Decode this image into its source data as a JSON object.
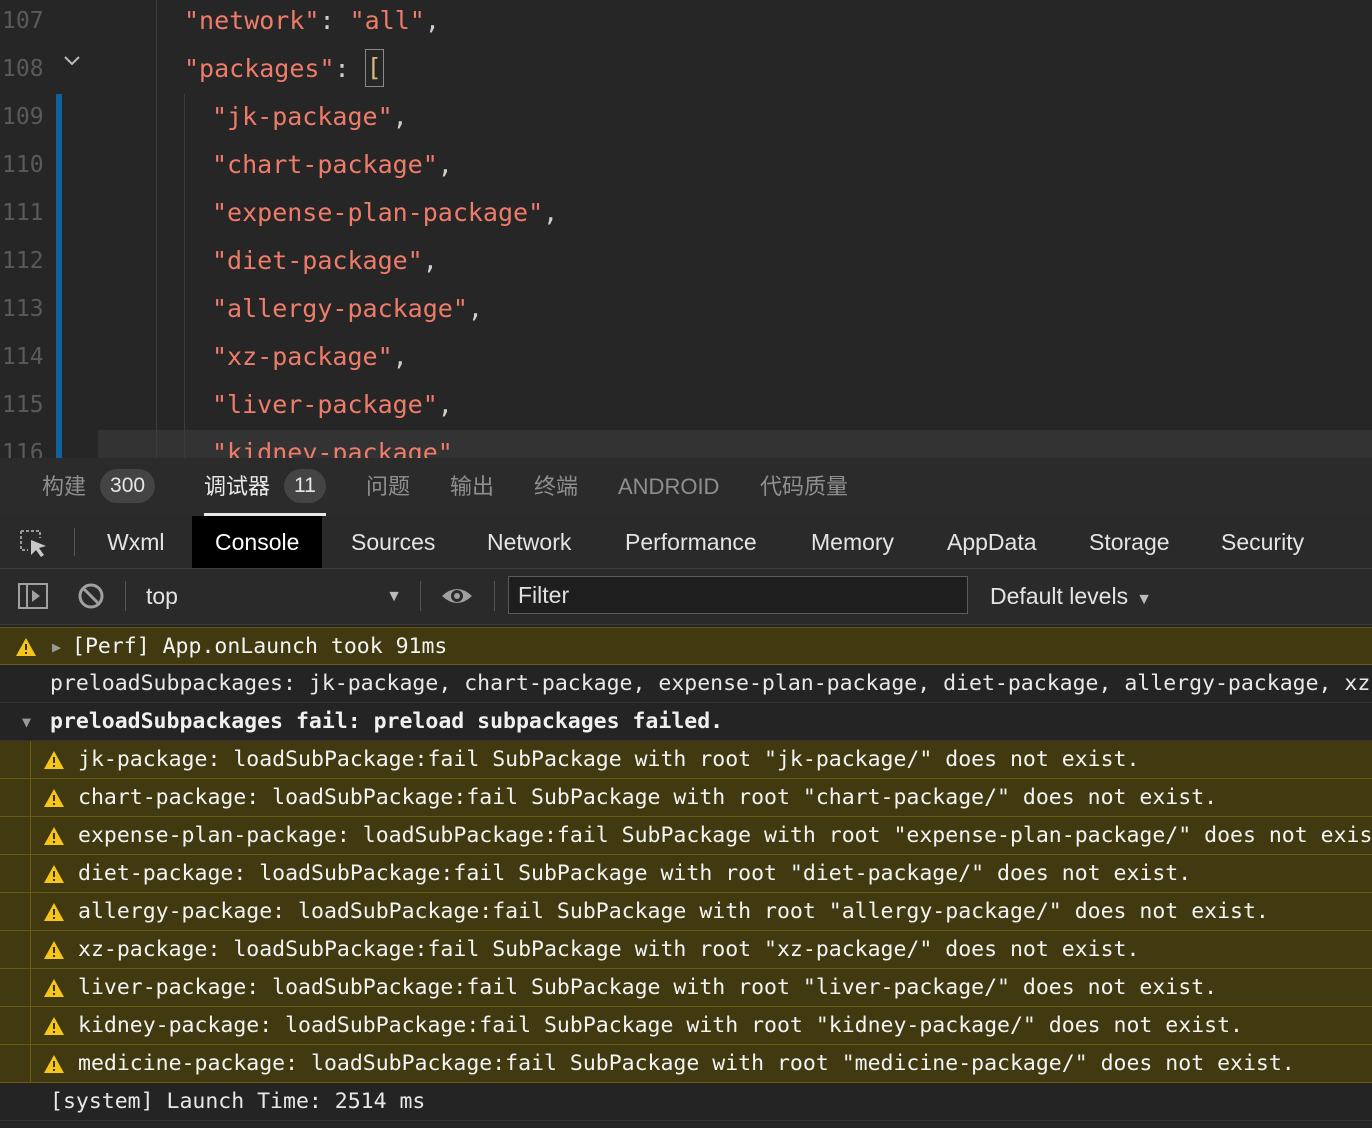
{
  "editor": {
    "lines": [
      {
        "num": "107",
        "segments": [
          [
            "str",
            "\"network\""
          ],
          [
            "punc",
            ": "
          ],
          [
            "str",
            "\"all\""
          ],
          [
            "punc",
            ","
          ]
        ]
      },
      {
        "num": "108",
        "segments": [
          [
            "str",
            "\"packages\""
          ],
          [
            "punc",
            ": "
          ]
        ],
        "bracket": "["
      },
      {
        "num": "109",
        "segments": [
          [
            "str",
            "\"jk-package\""
          ],
          [
            "punc",
            ","
          ]
        ]
      },
      {
        "num": "110",
        "segments": [
          [
            "str",
            "\"chart-package\""
          ],
          [
            "punc",
            ","
          ]
        ]
      },
      {
        "num": "111",
        "segments": [
          [
            "str",
            "\"expense-plan-package\""
          ],
          [
            "punc",
            ","
          ]
        ]
      },
      {
        "num": "112",
        "segments": [
          [
            "str",
            "\"diet-package\""
          ],
          [
            "punc",
            ","
          ]
        ]
      },
      {
        "num": "113",
        "segments": [
          [
            "str",
            "\"allergy-package\""
          ],
          [
            "punc",
            ","
          ]
        ]
      },
      {
        "num": "114",
        "segments": [
          [
            "str",
            "\"xz-package\""
          ],
          [
            "punc",
            ","
          ]
        ]
      },
      {
        "num": "115",
        "segments": [
          [
            "str",
            "\"liver-package\""
          ],
          [
            "punc",
            ","
          ]
        ]
      },
      {
        "num": "116",
        "segments": [
          [
            "str",
            "\"kidney-package\""
          ]
        ]
      }
    ]
  },
  "panel_tabs": {
    "build_label": "构建",
    "build_count": "300",
    "debugger_label": "调试器",
    "debugger_count": "11",
    "problems_label": "问题",
    "output_label": "输出",
    "terminal_label": "终端",
    "android_label": "ANDROID",
    "quality_label": "代码质量"
  },
  "devtools_tabs": {
    "wxml": "Wxml",
    "console": "Console",
    "sources": "Sources",
    "network": "Network",
    "performance": "Performance",
    "memory": "Memory",
    "appdata": "AppData",
    "storage": "Storage",
    "security": "Security"
  },
  "toolbar": {
    "context": "top",
    "filter_placeholder": "Filter",
    "levels": "Default levels"
  },
  "console": {
    "perf": "[Perf] App.onLaunch took 91ms",
    "preload": "preloadSubpackages: jk-package, chart-package, expense-plan-package, diet-package, allergy-package, xz-package, liver-package, kidney-package, medicine-package",
    "group": "preloadSubpackages fail: preload subpackages failed.",
    "errors": [
      "jk-package: loadSubPackage:fail SubPackage with root \"jk-package/\" does not exist.",
      "chart-package: loadSubPackage:fail SubPackage with root \"chart-package/\" does not exist.",
      "expense-plan-package: loadSubPackage:fail SubPackage with root \"expense-plan-package/\" does not exist.",
      "diet-package: loadSubPackage:fail SubPackage with root \"diet-package/\" does not exist.",
      "allergy-package: loadSubPackage:fail SubPackage with root \"allergy-package/\" does not exist.",
      "xz-package: loadSubPackage:fail SubPackage with root \"xz-package/\" does not exist.",
      "liver-package: loadSubPackage:fail SubPackage with root \"liver-package/\" does not exist.",
      "kidney-package: loadSubPackage:fail SubPackage with root \"kidney-package/\" does not exist.",
      "medicine-package: loadSubPackage:fail SubPackage with root \"medicine-package/\" does not exist."
    ],
    "system": "[system] Launch Time: 2514 ms"
  },
  "colors": {
    "string": "#ef7c6a",
    "warning_bg": "#413a10",
    "warning_icon": "#f5c518",
    "modified_bar": "#0e639c"
  }
}
